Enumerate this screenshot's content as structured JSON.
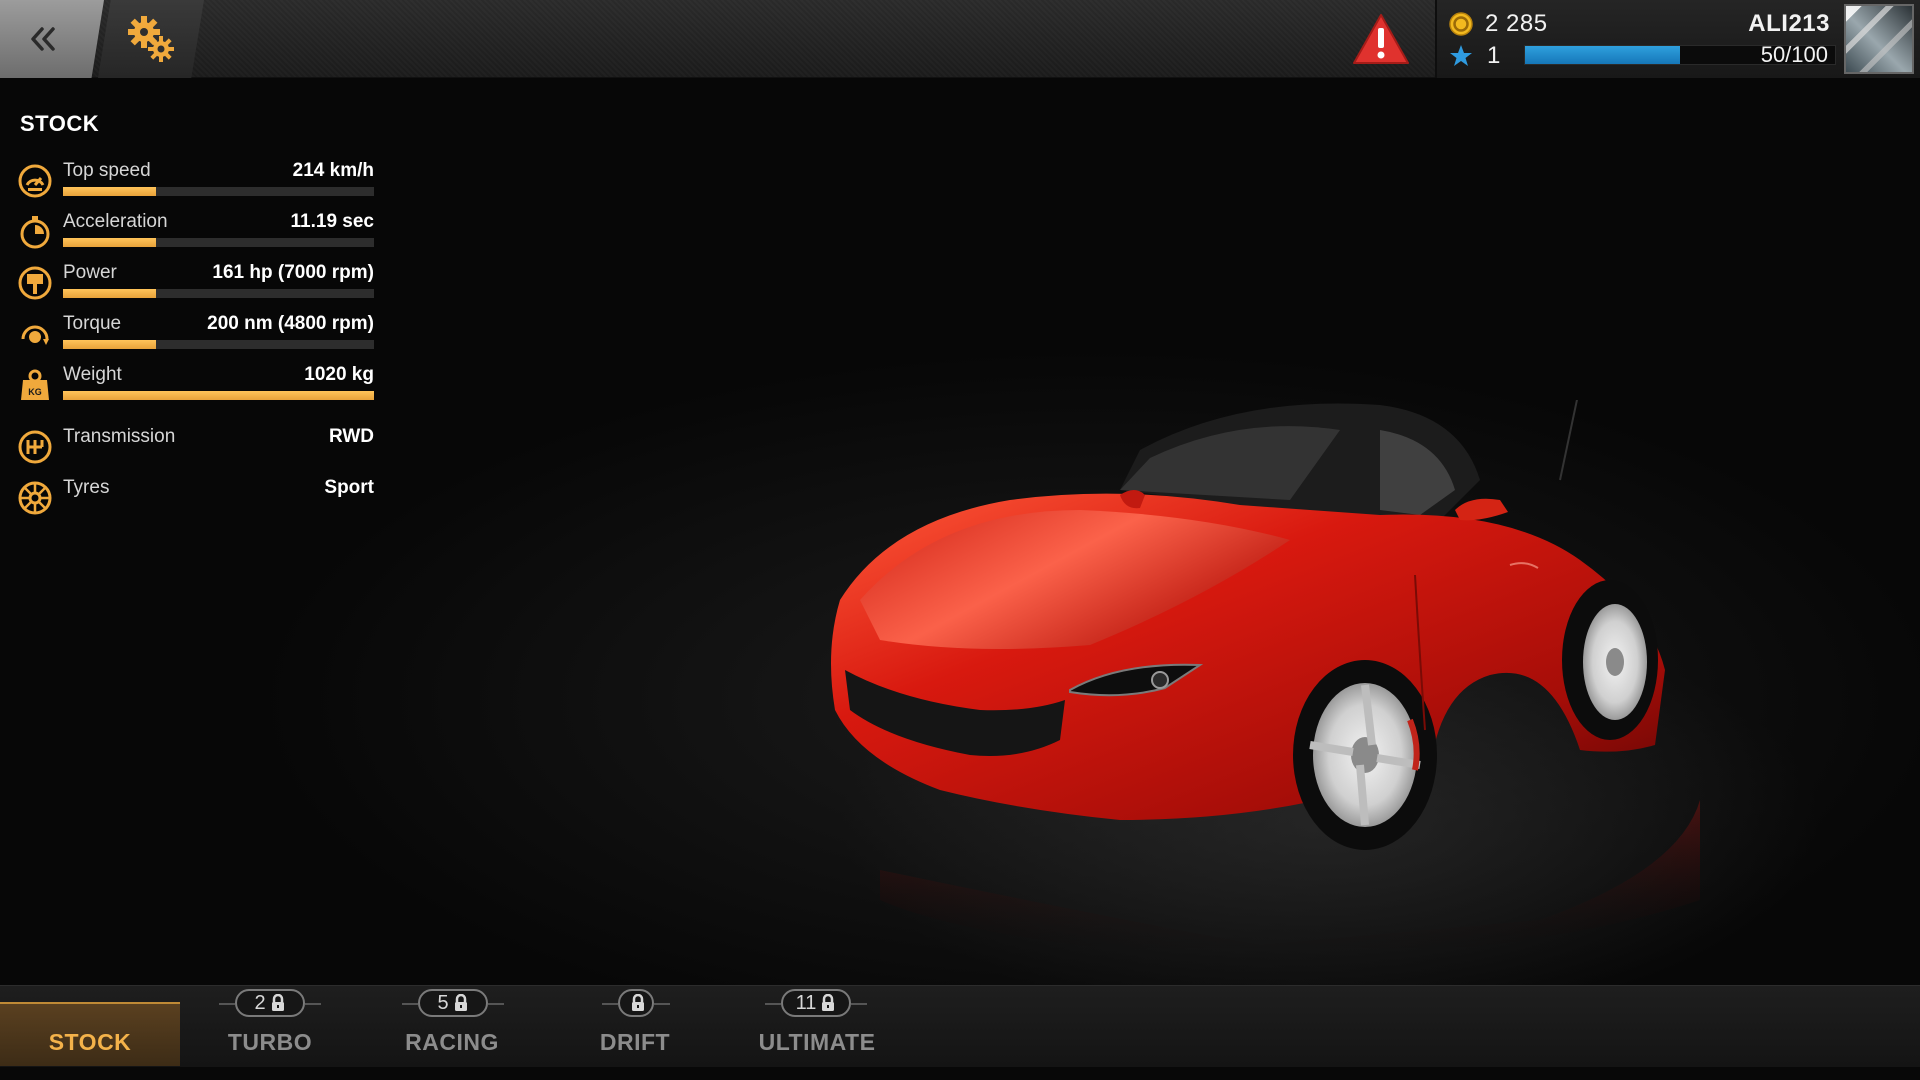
{
  "colors": {
    "accent": "#f0a93c",
    "xp_bar": "#1f8ed0",
    "warning": "#e0322e",
    "car_body": "#c8160f"
  },
  "header": {
    "back_icon": "double-chevron-left-icon",
    "settings_icon": "gears-icon",
    "warning_icon": "warning-triangle-icon",
    "currency_icon": "coin-icon",
    "level_icon": "star-icon",
    "coins": "2 285",
    "level": "1",
    "xp_text": "50/100",
    "xp_progress": 0.5,
    "username": "ALI213"
  },
  "panel": {
    "title": "STOCK",
    "stats": [
      {
        "label": "Top speed",
        "value": "214 km/h",
        "icon": "speedometer-icon",
        "fill": 0.3
      },
      {
        "label": "Acceleration",
        "value": "11.19 sec",
        "icon": "stopwatch-icon",
        "fill": 0.3
      },
      {
        "label": "Power",
        "value": "161 hp (7000 rpm)",
        "icon": "piston-icon",
        "fill": 0.3
      },
      {
        "label": "Torque",
        "value": "200 nm (4800 rpm)",
        "icon": "torque-icon",
        "fill": 0.3
      },
      {
        "label": "Weight",
        "value": "1020 kg",
        "icon": "weight-icon",
        "fill": 1.0
      },
      {
        "label": "Transmission",
        "value": "RWD",
        "icon": "gearbox-icon"
      },
      {
        "label": "Tyres",
        "value": "Sport",
        "icon": "tyre-icon"
      }
    ]
  },
  "tabs": [
    {
      "label": "STOCK",
      "active": true
    },
    {
      "label": "TURBO",
      "lock_count": "2"
    },
    {
      "label": "RACING",
      "lock_count": "5"
    },
    {
      "label": "DRIFT",
      "lock_count": ""
    },
    {
      "label": "ULTIMATE",
      "lock_count": "11"
    }
  ]
}
